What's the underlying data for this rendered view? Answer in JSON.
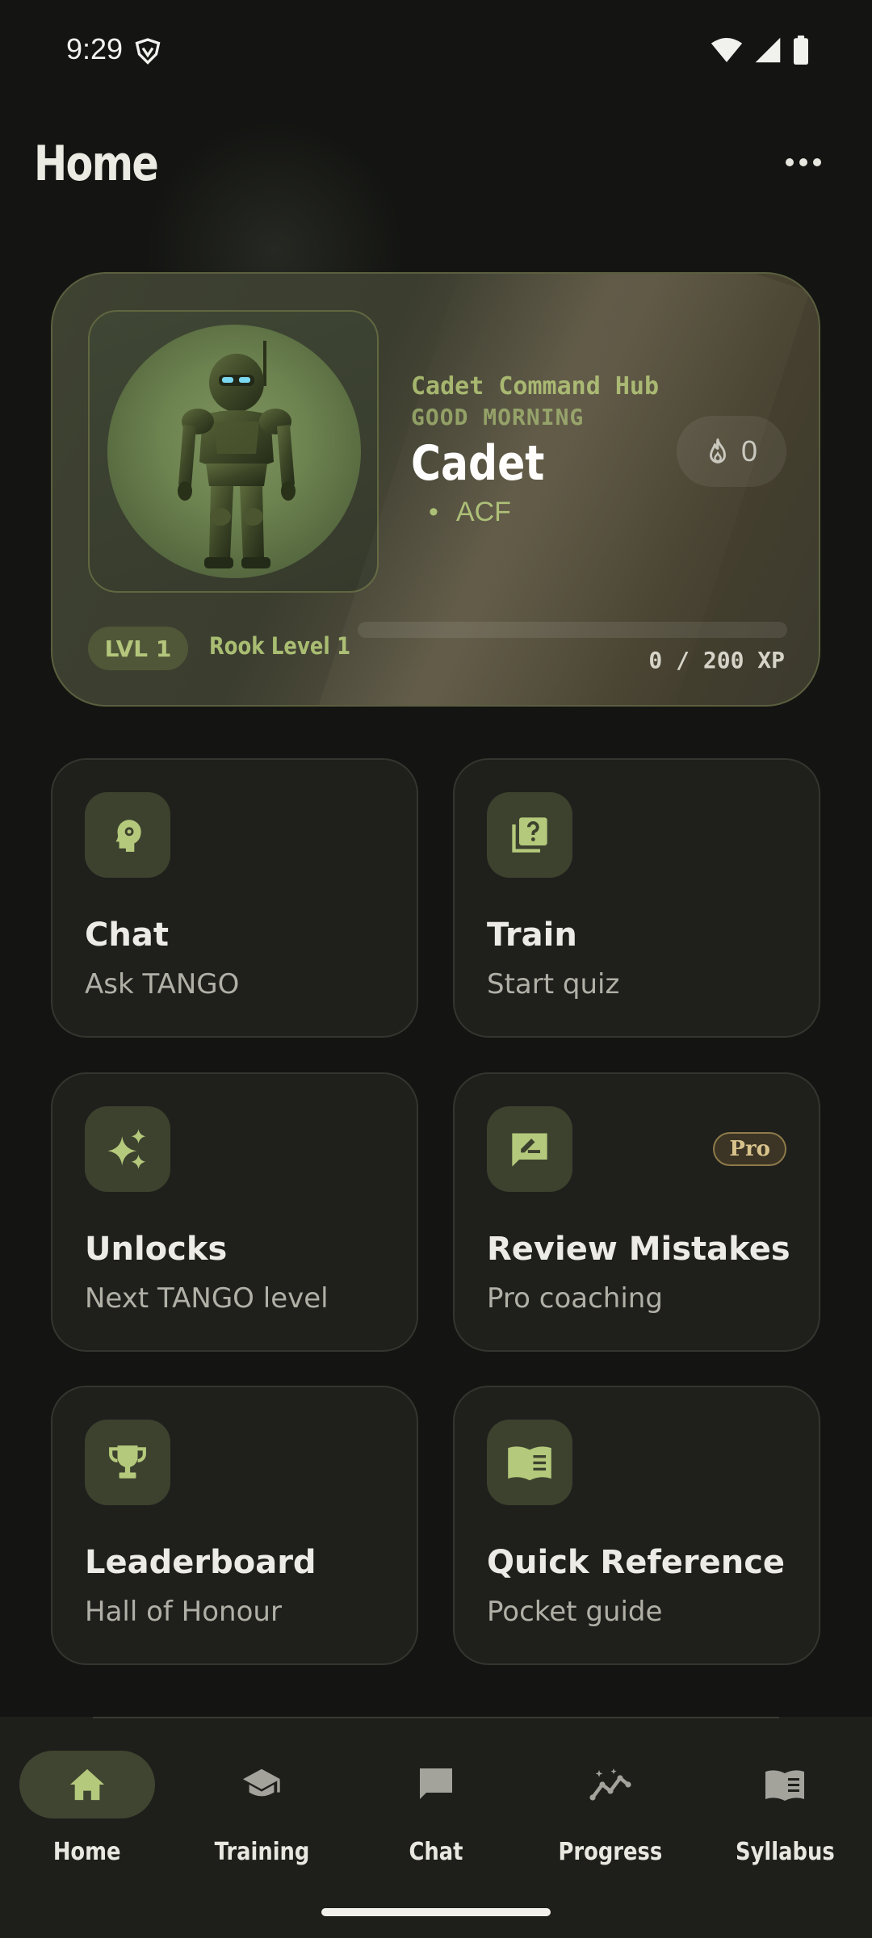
{
  "status_bar": {
    "time": "9:29"
  },
  "header": {
    "title": "Home"
  },
  "hero": {
    "hub_label": "Cadet Command Hub",
    "greeting": "GOOD MORNING",
    "name": "Cadet",
    "unit": "ACF",
    "streak_count": "0",
    "level_badge": "LVL 1",
    "rank_label": "Rook Level 1",
    "xp_label": "0 / 200 XP",
    "xp_progress": 0.0
  },
  "tiles": [
    {
      "title": "Chat",
      "subtitle": "Ask TANGO",
      "icon": "brain-gear-icon"
    },
    {
      "title": "Train",
      "subtitle": "Start quiz",
      "icon": "quiz-icon"
    },
    {
      "title": "Unlocks",
      "subtitle": "Next TANGO level",
      "icon": "sparkle-icon"
    },
    {
      "title": "Review Mistakes",
      "subtitle": "Pro coaching",
      "icon": "rate-review-icon",
      "badge": "Pro"
    },
    {
      "title": "Leaderboard",
      "subtitle": "Hall of Honour",
      "icon": "trophy-icon"
    },
    {
      "title": "Quick Reference",
      "subtitle": "Pocket guide",
      "icon": "book-icon"
    }
  ],
  "bottom_nav": [
    {
      "label": "Home",
      "icon": "home-icon",
      "active": true
    },
    {
      "label": "Training",
      "icon": "school-icon",
      "active": false
    },
    {
      "label": "Chat",
      "icon": "chat-icon",
      "active": false
    },
    {
      "label": "Progress",
      "icon": "insights-icon",
      "active": false
    },
    {
      "label": "Syllabus",
      "icon": "book-icon",
      "active": false
    }
  ],
  "colors": {
    "background": "#141512",
    "accent": "#a9bd72",
    "tile_background": "#1f201c",
    "icon_tile": "#3c422e",
    "pro_badge": "#d8c38c"
  }
}
